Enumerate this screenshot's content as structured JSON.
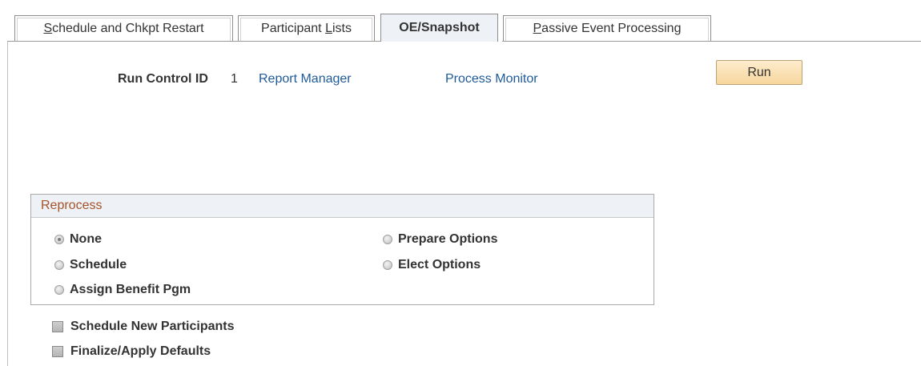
{
  "tabs": [
    {
      "prefix": "",
      "accel": "S",
      "rest": "chedule and Chkpt Restart"
    },
    {
      "prefix": "Participant ",
      "accel": "L",
      "rest": "ists"
    },
    {
      "prefix": "",
      "accel": "",
      "rest": "OE/Snapshot"
    },
    {
      "prefix": "",
      "accel": "P",
      "rest": "assive Event Processing"
    }
  ],
  "header": {
    "run_control_label": "Run Control ID",
    "run_control_value": "1",
    "report_manager": "Report Manager",
    "process_monitor": "Process Monitor",
    "run_button": "Run"
  },
  "reprocess": {
    "title": "Reprocess",
    "options": [
      {
        "label": "None",
        "checked": true
      },
      {
        "label": "Schedule",
        "checked": false
      },
      {
        "label": "Assign Benefit Pgm",
        "checked": false
      },
      {
        "label": "Prepare Options",
        "checked": false
      },
      {
        "label": "Elect Options",
        "checked": false
      }
    ]
  },
  "checkboxes": [
    {
      "label": "Schedule New Participants",
      "checked": false
    },
    {
      "label": "Finalize/Apply Defaults",
      "checked": false
    }
  ],
  "colors": {
    "link": "#1f5a99",
    "group_title": "#a5522a",
    "run_button_bg": "#f6d69d",
    "active_tab_bg": "#eef2f6"
  }
}
